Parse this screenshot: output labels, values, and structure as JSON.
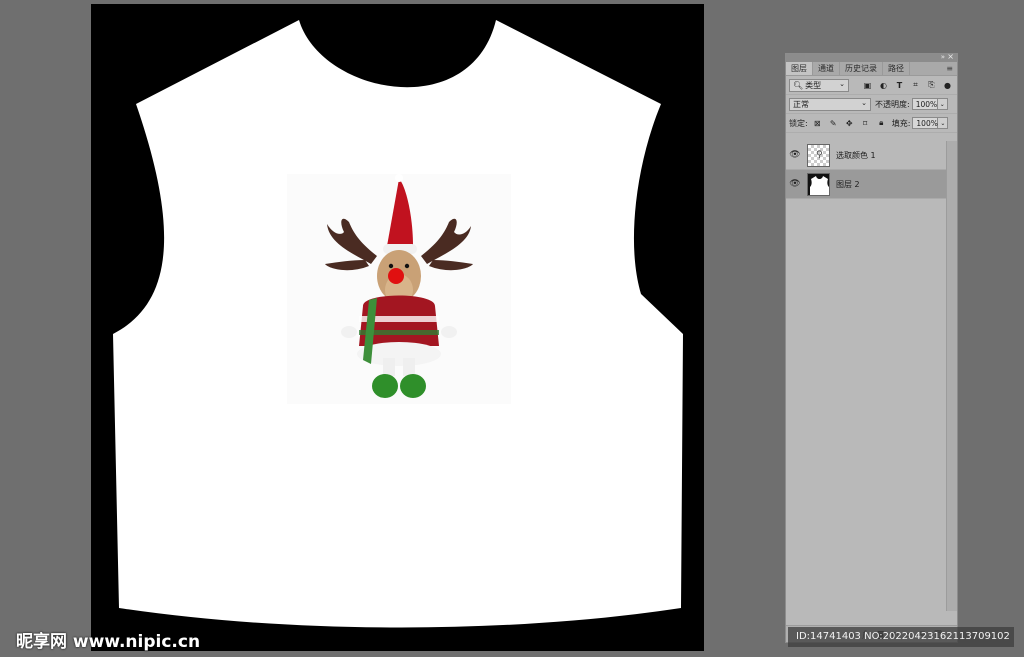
{
  "panel": {
    "tabs": [
      {
        "label": "图层",
        "active": true
      },
      {
        "label": "通道",
        "active": false
      },
      {
        "label": "历史记录",
        "active": false
      },
      {
        "label": "路径",
        "active": false
      }
    ],
    "filter_kind": "类型",
    "blend_mode": "正常",
    "opacity_label": "不透明度:",
    "opacity_value": "100%",
    "lock_label": "锁定:",
    "fill_label": "填充:",
    "fill_value": "100%",
    "layers": [
      {
        "name": "选取颜色 1",
        "thumb": "adjustment",
        "visible": true,
        "selected": false
      },
      {
        "name": "图层 2",
        "thumb": "shirt",
        "visible": true,
        "selected": true
      }
    ],
    "footer_icons": [
      "link-icon",
      "fx-icon",
      "mask-icon",
      "adjustment-icon",
      "folder-icon",
      "new-layer-icon",
      "trash-icon"
    ]
  },
  "document": {
    "shirt_color": "#ffffff",
    "background_color": "#000000",
    "graphic": "reindeer plush toy with red hat and knitted sweater"
  },
  "watermark": {
    "logo": "昵享网 www.nipic.cn",
    "id_text": "ID:14741403 NO:20220423162113709102"
  }
}
